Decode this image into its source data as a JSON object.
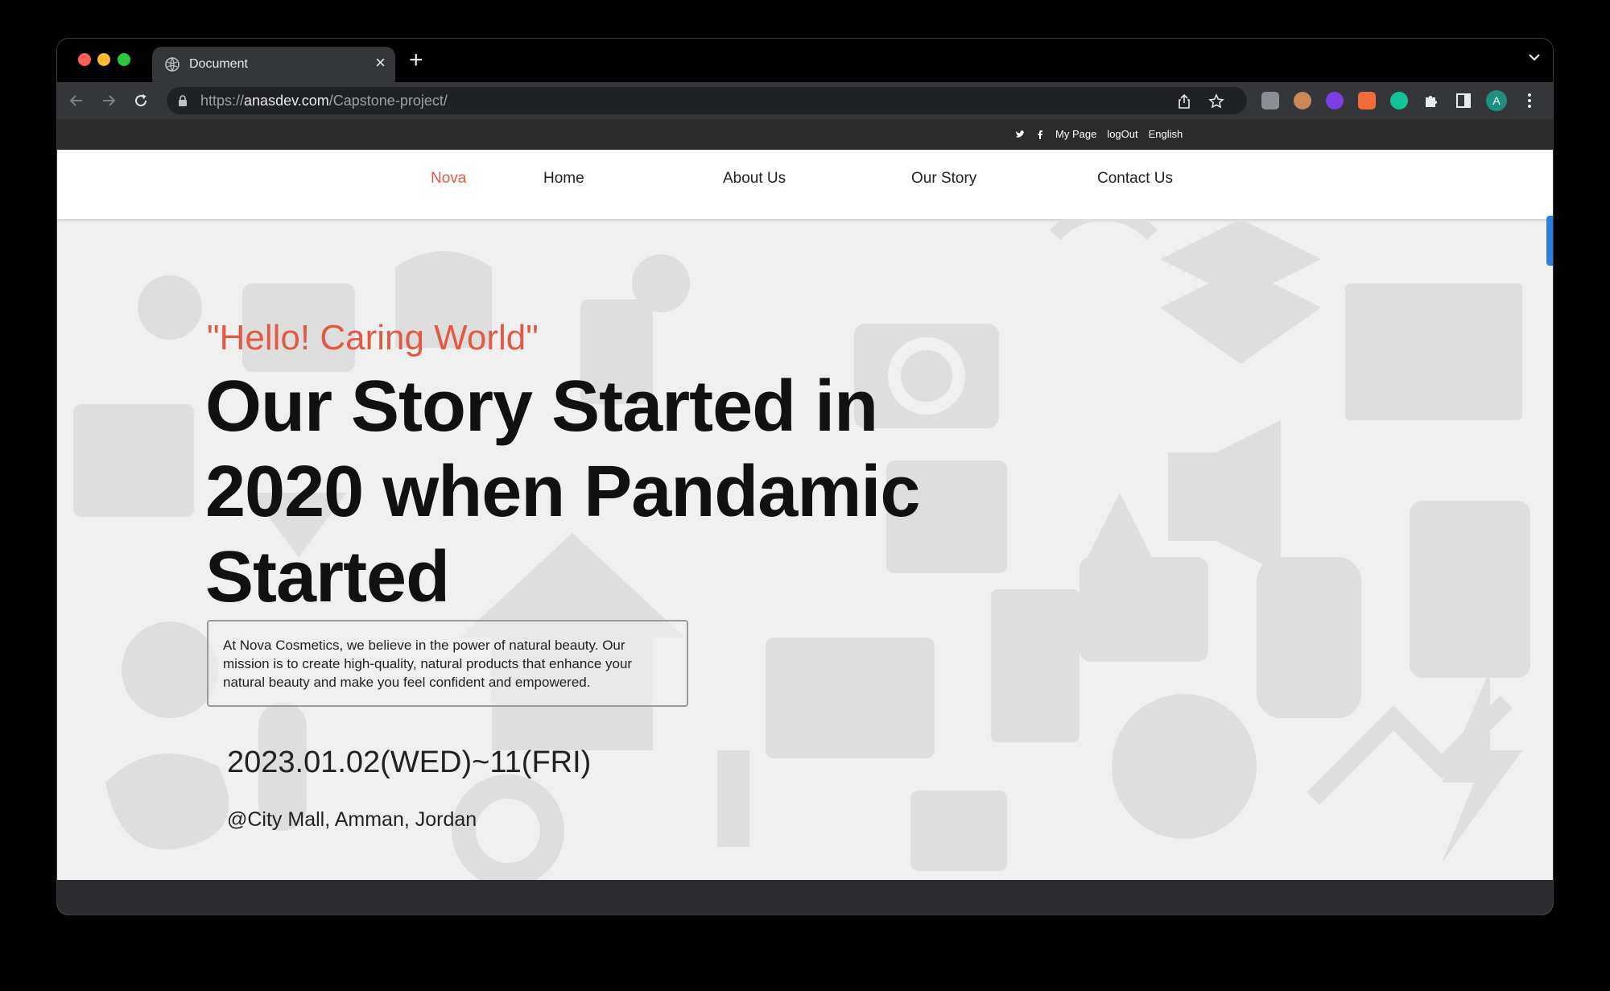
{
  "browser": {
    "tab_title": "Document",
    "url_scheme": "https://",
    "url_host": "anasdev.com",
    "url_path": "/Capstone-project/"
  },
  "topbar": {
    "icons": [
      "twitter-icon",
      "facebook-icon"
    ],
    "my_page": "My Page",
    "logout": "logOut",
    "language": "English"
  },
  "nav": {
    "brand": "Nova",
    "items": [
      "Home",
      "About Us",
      "Our Story",
      "Contact Us"
    ],
    "brand_color": "#e05a44"
  },
  "hero": {
    "tagline": "\"Hello! Caring World\"",
    "headline_line1": "Our Story Started in",
    "headline_line2": "2020 when Pandamic",
    "headline_line3": "Started",
    "description": "At Nova Cosmetics, we believe in the power of natural beauty. Our mission is to create high-quality, natural products that enhance your natural beauty and make you feel confident and empowered.",
    "date": "2023.01.02(WED)~11(FRI)",
    "location": "@City Mall, Amman, Jordan"
  },
  "colors": {
    "accent": "#e05a44",
    "dark": "#2b2b2b",
    "scroll_indicator": "#2f7de1"
  }
}
